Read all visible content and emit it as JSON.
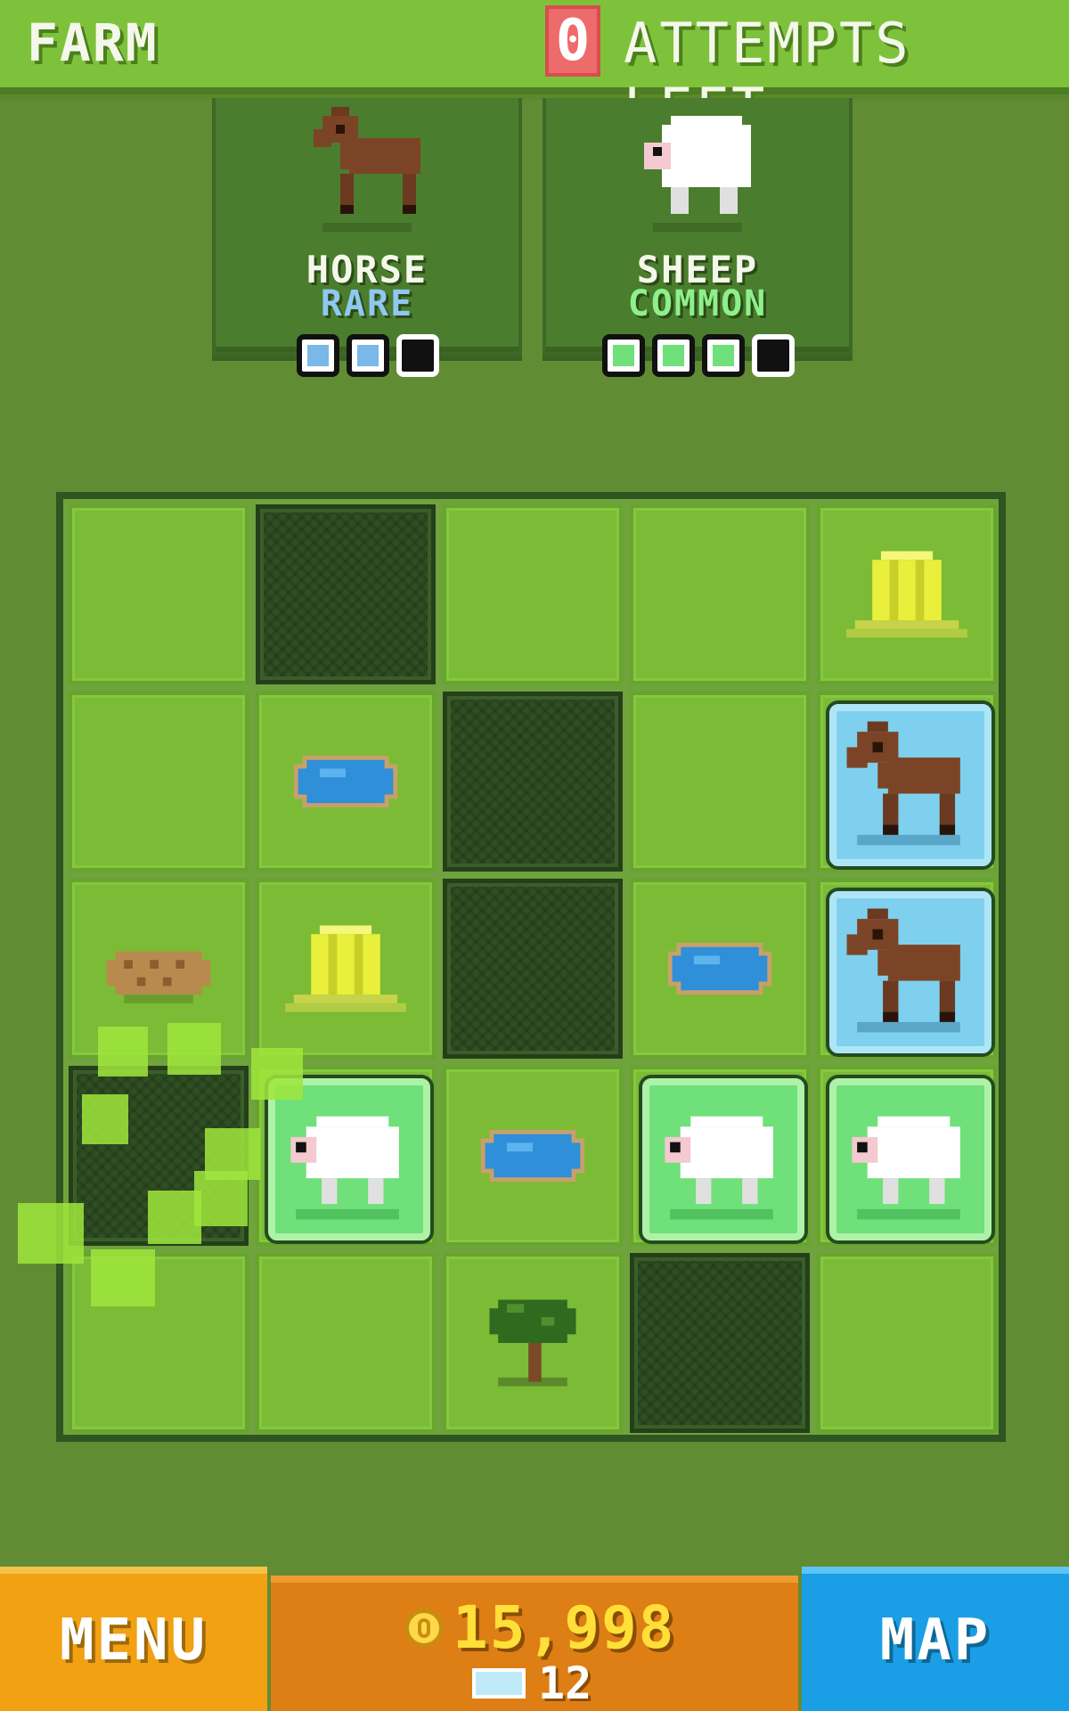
{
  "header": {
    "title": "FARM",
    "attempts_count": "0",
    "attempts_label": "ATTEMPTS LEFT"
  },
  "goals": [
    {
      "name": "HORSE",
      "rarity": "RARE",
      "rarity_color": "#8fc8f0",
      "progress": {
        "filled": 2,
        "total": 3
      },
      "progress_color": "#7ab8e8",
      "animal_icon": "horse-icon"
    },
    {
      "name": "SHEEP",
      "rarity": "COMMON",
      "rarity_color": "#8ef08a",
      "progress": {
        "filled": 3,
        "total": 4
      },
      "progress_color": "#6fe07a",
      "animal_icon": "sheep-icon"
    }
  ],
  "board": {
    "rows": 5,
    "cols": 5,
    "cells": [
      [
        "grass",
        "dark",
        "grass",
        "grass",
        "hay"
      ],
      [
        "grass",
        "pond",
        "dark",
        "grass",
        "horse-tile"
      ],
      [
        "nest",
        "hay",
        "dark",
        "pond",
        "horse-tile"
      ],
      [
        "dark",
        "sheep-tile",
        "pond",
        "sheep-tile",
        "sheep-tile"
      ],
      [
        "grass",
        "grass",
        "tree",
        "dark",
        "grass"
      ]
    ]
  },
  "footer": {
    "menu_label": "MENU",
    "coins": "15,998",
    "gems": "12",
    "map_label": "MAP"
  },
  "colors": {
    "background": "#628c34",
    "menu_button": "#f2a113",
    "map_button": "#1a9fe6",
    "currency_panel": "#dd7f14",
    "attempts_badge": "#ee6b6b"
  }
}
